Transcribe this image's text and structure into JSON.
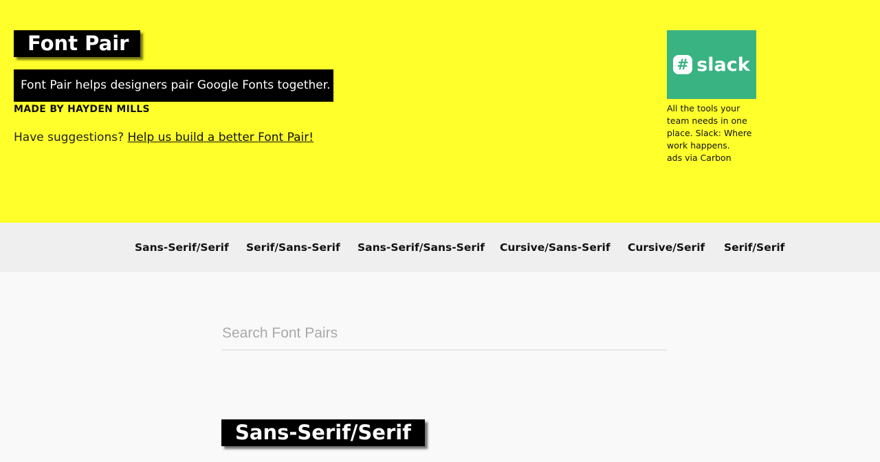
{
  "header": {
    "title": "Font Pair",
    "tagline": "Font Pair helps designers pair Google Fonts together.",
    "credit": "MADE BY HAYDEN MILLS",
    "suggest_text": "Have suggestions?",
    "suggest_link": "Help us build a better Font Pair!",
    "background_color": "#ffff2b"
  },
  "ad": {
    "brand_icon": "slack-logo-icon",
    "brand_name": "slack",
    "brand_mark": "#",
    "brand_color": "#3ab383",
    "text": "All the tools your team needs in one place. Slack: Where work happens.",
    "via": "ads via Carbon"
  },
  "categories": [
    "Sans-Serif/Serif",
    "Serif/Sans-Serif",
    "Sans-Serif/Sans-Serif",
    "Cursive/Sans-Serif",
    "Cursive/Serif",
    "Serif/Serif"
  ],
  "search": {
    "placeholder": "Search Font Pairs",
    "value": ""
  },
  "section": {
    "heading": "Sans-Serif/Serif"
  }
}
